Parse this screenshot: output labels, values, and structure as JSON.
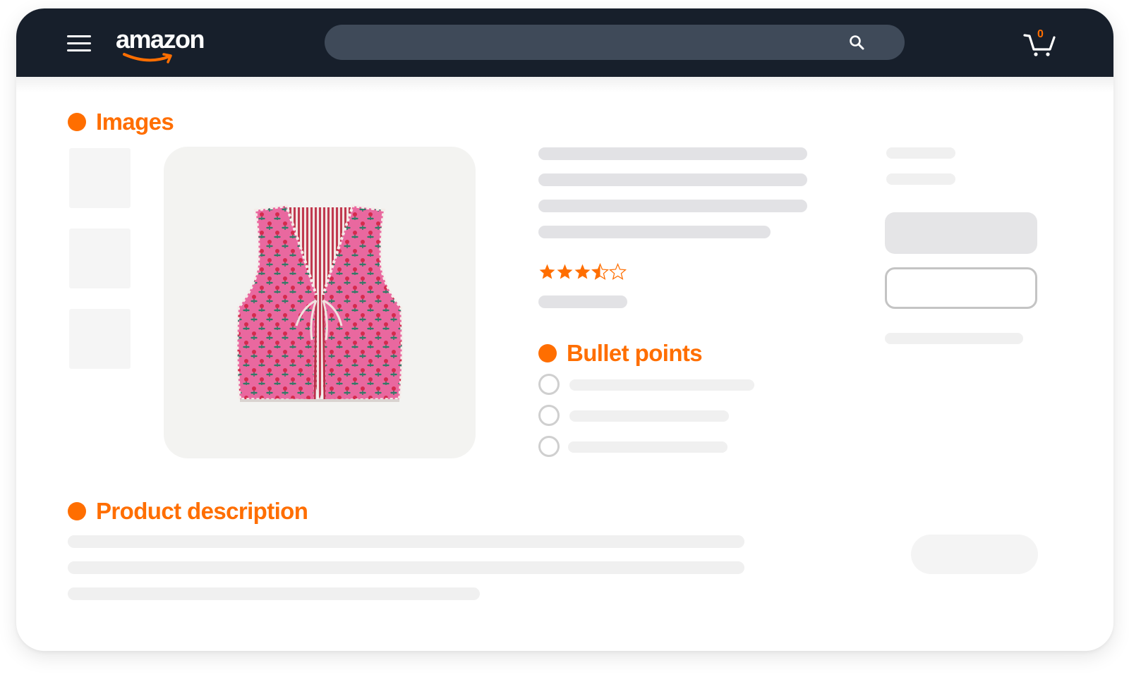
{
  "navbar": {
    "logo_text": "amazon",
    "search": {
      "value": "",
      "placeholder": ""
    },
    "cart_count": "0"
  },
  "sections": {
    "images": "Images",
    "bullet_points": "Bullet points",
    "product_description": "Product description"
  },
  "product": {
    "rating": 3.5,
    "rating_max": 5
  },
  "colors": {
    "accent": "#ff6e00",
    "navbar_bg": "#171f2b",
    "search_bg": "#3f4a59",
    "vest_pink": "#e9689f"
  },
  "icons": [
    "hamburger-menu-icon",
    "search-icon",
    "cart-icon",
    "star-icon",
    "radio-circle-icon"
  ]
}
